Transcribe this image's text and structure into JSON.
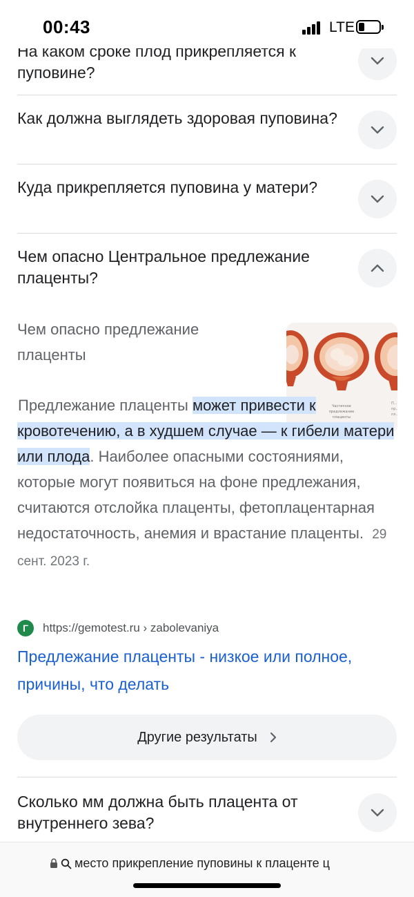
{
  "status": {
    "time": "00:43",
    "network": "LTE"
  },
  "faqs_top": [
    {
      "question": "На каком сроке плод прикрепляется к пуповине?",
      "chevron": "chevron-down-icon"
    },
    {
      "question": "Как должна выглядеть здоровая пуповина?",
      "chevron": "chevron-down-icon"
    },
    {
      "question": "Куда прикрепляется пуповина у матери?",
      "chevron": "chevron-down-icon"
    },
    {
      "question": "Чем опасно Центральное предлежание плаценты?",
      "chevron": "chevron-up-icon",
      "expanded": true
    }
  ],
  "answer": {
    "heading": "Чем опасно предлежание плаценты",
    "text_before": "Предлежание плаценты ",
    "highlight": "может привести к кровотечению, а в худшем случае — к гибели матери или плода",
    "text_after": ". Наиболее опасными состояниями, которые могут появиться на фоне предлежания, считаются отслойка плаценты, фетоплацентарная недостаточность, анемия и врастание плаценты.",
    "date": "29 сент. 2023 г.",
    "image_captions": [
      "...ая ...а",
      "Частичное предлежание плаценты",
      "П... пр... пл..."
    ]
  },
  "source": {
    "favicon_letter": "Г",
    "url": "https://gemotest.ru › zabolevaniya",
    "title": "Предлежание плаценты - низкое или полное, причины, что делать"
  },
  "more_results": {
    "label": "Другие результаты"
  },
  "faqs_bottom": [
    {
      "question": "Сколько мм должна быть плацента от внутреннего зева?",
      "chevron": "chevron-down-icon"
    }
  ],
  "addressbar": {
    "query": "место прикрепление пуповины к плаценте ц"
  },
  "colors": {
    "highlight": "#d2e3fc",
    "link": "#1a5fd0",
    "chip_bg": "#f1f3f4"
  }
}
